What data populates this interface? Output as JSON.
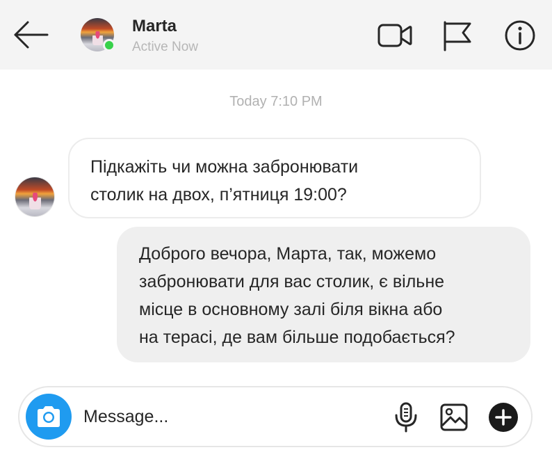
{
  "header": {
    "contact_name": "Marta",
    "status": "Active Now",
    "online_color": "#38d14a",
    "icons": [
      "back-arrow-icon",
      "video-camera-icon",
      "flag-icon",
      "info-icon"
    ]
  },
  "conversation": {
    "timestamp": "Today 7:10 PM",
    "messages": [
      {
        "direction": "incoming",
        "lines": [
          "Підкажіть чи можна забронювати",
          "столик на двох, п’ятниця 19:00?"
        ]
      },
      {
        "direction": "outgoing",
        "lines": [
          "Доброго вечора, Марта, так, можемо",
          "забронювати для вас столик, є вільне",
          "місце в основному залі біля вікна або",
          "на терасі, де вам більше подобається?"
        ]
      }
    ]
  },
  "composer": {
    "placeholder": "Message...",
    "value": "",
    "accent_color": "#1f9bf0",
    "icons": [
      "camera-icon",
      "microphone-icon",
      "image-icon",
      "plus-icon"
    ]
  }
}
